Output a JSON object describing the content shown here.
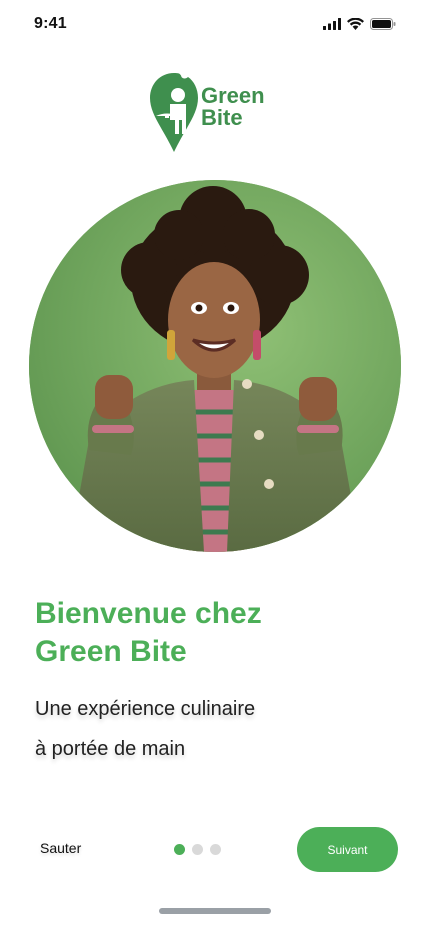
{
  "status_bar": {
    "time": "9:41",
    "icons": [
      "signal-icon",
      "wifi-icon",
      "battery-icon"
    ]
  },
  "logo": {
    "line1": "Green",
    "line2": "Bite",
    "icon": "chef-pin-icon",
    "color": "#3f8f4e"
  },
  "hero": {
    "image": "smiling woman with curly hair in green jacket, fists raised",
    "background": "#7fb267"
  },
  "onboarding": {
    "title_line1": "Bienvenue chez",
    "title_line2": "Green Bite",
    "subtitle_line1": "Une expérience culinaire",
    "subtitle_line2": "à portée de main",
    "current_page": 1,
    "total_pages": 3
  },
  "footer": {
    "skip_label": "Sauter",
    "next_label": "Suivant"
  },
  "colors": {
    "accent": "#4caf58",
    "dot_inactive": "#d9d9d9"
  }
}
